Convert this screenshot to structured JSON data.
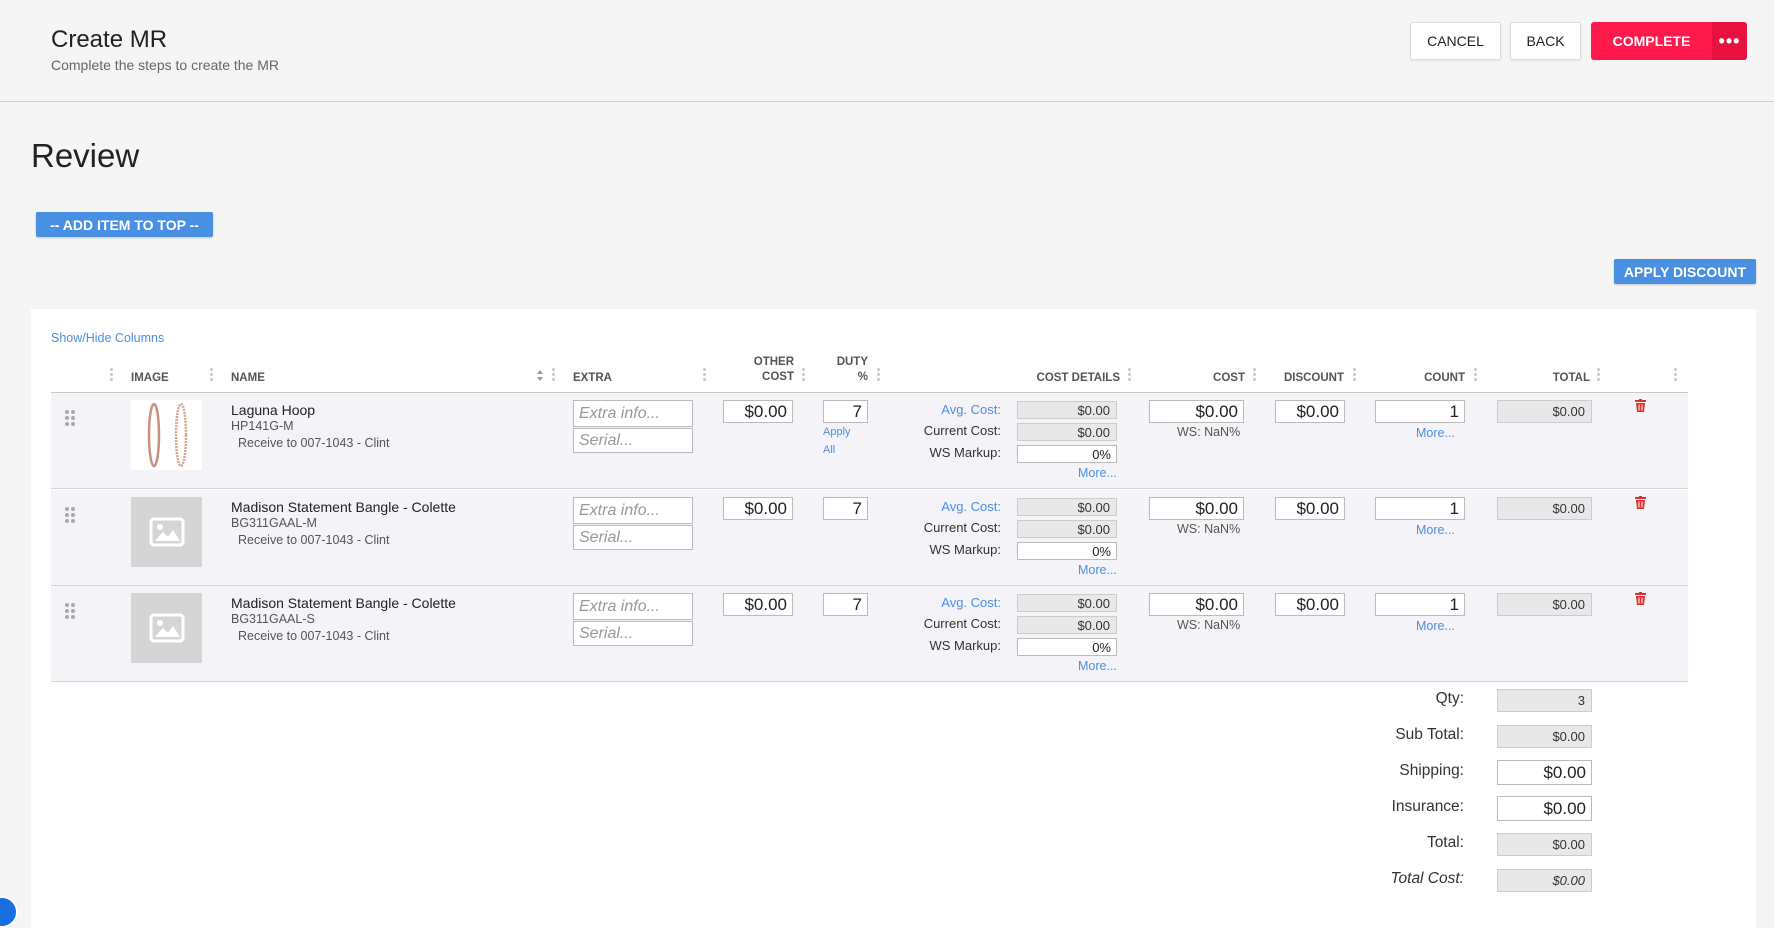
{
  "header": {
    "title": "Create MR",
    "subtitle": "Complete the steps to create the MR",
    "cancel_label": "CANCEL",
    "back_label": "BACK",
    "complete_label": "COMPLETE",
    "more_label": "•••"
  },
  "section_title": "Review",
  "add_item_top_label": "-- ADD ITEM TO TOP --",
  "apply_discount_label": "APPLY DISCOUNT",
  "show_hide_label": "Show/Hide Columns",
  "columns": {
    "image": "IMAGE",
    "name": "NAME",
    "extra": "EXTRA",
    "other_cost_1": "OTHER",
    "other_cost_2": "COST",
    "duty_1": "DUTY",
    "duty_2": "%",
    "cost_details": "COST DETAILS",
    "cost": "COST",
    "discount": "DISCOUNT",
    "count": "COUNT",
    "total": "TOTAL"
  },
  "row_labels": {
    "avg_cost": "Avg. Cost:",
    "current_cost": "Current Cost:",
    "ws_markup": "WS Markup:",
    "more": "More...",
    "extra_placeholder": "Extra info...",
    "serial_placeholder": "Serial...",
    "apply": "Apply",
    "all": "All"
  },
  "items": [
    {
      "name": "Laguna Hoop",
      "sku": "HP141G-M",
      "receive": "Receive to 007-1043 - Clint",
      "other_cost": "$0.00",
      "duty": "7",
      "avg_cost": "$0.00",
      "current_cost": "$0.00",
      "ws_markup": "0%",
      "cost": "$0.00",
      "ws": "WS: NaN%",
      "discount": "$0.00",
      "count": "1",
      "total": "$0.00"
    },
    {
      "name": "Madison Statement Bangle - Colette",
      "sku": "BG311GAAL-M",
      "receive": "Receive to 007-1043 - Clint",
      "other_cost": "$0.00",
      "duty": "7",
      "avg_cost": "$0.00",
      "current_cost": "$0.00",
      "ws_markup": "0%",
      "cost": "$0.00",
      "ws": "WS: NaN%",
      "discount": "$0.00",
      "count": "1",
      "total": "$0.00"
    },
    {
      "name": "Madison Statement Bangle - Colette",
      "sku": "BG311GAAL-S",
      "receive": "Receive to 007-1043 - Clint",
      "other_cost": "$0.00",
      "duty": "7",
      "avg_cost": "$0.00",
      "current_cost": "$0.00",
      "ws_markup": "0%",
      "cost": "$0.00",
      "ws": "WS: NaN%",
      "discount": "$0.00",
      "count": "1",
      "total": "$0.00"
    }
  ],
  "summary": {
    "qty_label": "Qty:",
    "qty": "3",
    "subtotal_label": "Sub Total:",
    "subtotal": "$0.00",
    "shipping_label": "Shipping:",
    "shipping": "$0.00",
    "insurance_label": "Insurance:",
    "insurance": "$0.00",
    "total_label": "Total:",
    "total": "$0.00",
    "total_cost_label": "Total Cost:",
    "total_cost": "$0.00"
  },
  "colors": {
    "accent": "#4a90e2",
    "complete": "#ff1a4b",
    "trash": "#e0302a"
  }
}
